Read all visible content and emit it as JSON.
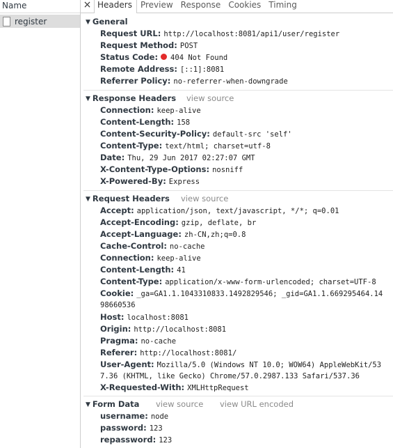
{
  "left_panel": {
    "header": "Name",
    "request_name": "register"
  },
  "tabs": {
    "close": "×",
    "items": [
      "Headers",
      "Preview",
      "Response",
      "Cookies",
      "Timing"
    ],
    "active": "Headers"
  },
  "general": {
    "title": "General",
    "rows": [
      {
        "key": "Request URL:",
        "value": "http://localhost:8081/api1/user/register"
      },
      {
        "key": "Request Method:",
        "value": "POST"
      },
      {
        "key": "Status Code:",
        "value": "404 Not Found",
        "status_color": "#e32b2b"
      },
      {
        "key": "Remote Address:",
        "value": "[::1]:8081"
      },
      {
        "key": "Referrer Policy:",
        "value": "no-referrer-when-downgrade"
      }
    ]
  },
  "response_headers": {
    "title": "Response Headers",
    "view_source": "view source",
    "rows": [
      {
        "key": "Connection:",
        "value": "keep-alive"
      },
      {
        "key": "Content-Length:",
        "value": "158"
      },
      {
        "key": "Content-Security-Policy:",
        "value": "default-src 'self'"
      },
      {
        "key": "Content-Type:",
        "value": "text/html; charset=utf-8"
      },
      {
        "key": "Date:",
        "value": "Thu, 29 Jun 2017 02:27:07 GMT"
      },
      {
        "key": "X-Content-Type-Options:",
        "value": "nosniff"
      },
      {
        "key": "X-Powered-By:",
        "value": "Express"
      }
    ]
  },
  "request_headers": {
    "title": "Request Headers",
    "view_source": "view source",
    "rows": [
      {
        "key": "Accept:",
        "value": "application/json, text/javascript, */*; q=0.01"
      },
      {
        "key": "Accept-Encoding:",
        "value": "gzip, deflate, br"
      },
      {
        "key": "Accept-Language:",
        "value": "zh-CN,zh;q=0.8"
      },
      {
        "key": "Cache-Control:",
        "value": "no-cache"
      },
      {
        "key": "Connection:",
        "value": "keep-alive"
      },
      {
        "key": "Content-Length:",
        "value": "41"
      },
      {
        "key": "Content-Type:",
        "value": "application/x-www-form-urlencoded; charset=UTF-8"
      },
      {
        "key": "Cookie:",
        "value": "_ga=GA1.1.1043310833.1492829546; _gid=GA1.1.669295464.14",
        "cont": "98660536"
      },
      {
        "key": "Host:",
        "value": "localhost:8081"
      },
      {
        "key": "Origin:",
        "value": "http://localhost:8081"
      },
      {
        "key": "Pragma:",
        "value": "no-cache"
      },
      {
        "key": "Referer:",
        "value": "http://localhost:8081/"
      },
      {
        "key": "User-Agent:",
        "value": "Mozilla/5.0 (Windows NT 10.0; WOW64) AppleWebKit/53",
        "cont": "7.36 (KHTML, like Gecko) Chrome/57.0.2987.133 Safari/537.36"
      },
      {
        "key": "X-Requested-With:",
        "value": "XMLHttpRequest"
      }
    ]
  },
  "form_data": {
    "title": "Form Data",
    "view_source": "view source",
    "view_url_encoded": "view URL encoded",
    "rows": [
      {
        "key": "username:",
        "value": "node"
      },
      {
        "key": "password:",
        "value": "123"
      },
      {
        "key": "repassword:",
        "value": "123"
      }
    ]
  }
}
